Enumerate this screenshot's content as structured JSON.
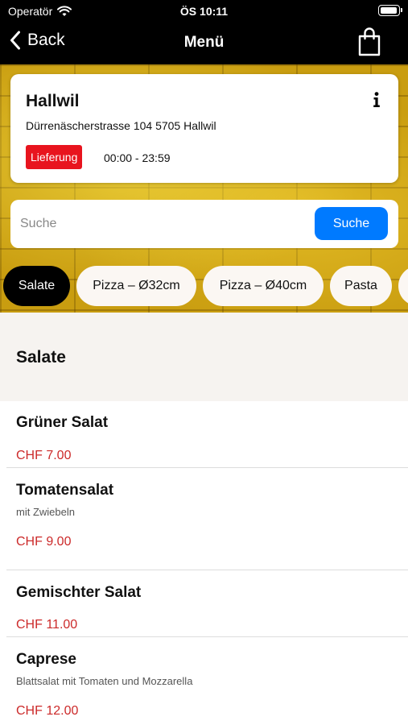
{
  "status_bar": {
    "carrier": "Operatör",
    "time": "ÖS 10:11"
  },
  "nav": {
    "back_label": "Back",
    "title": "Menü"
  },
  "store": {
    "name": "Hallwil",
    "address": "Dürrenäscherstrasse 104 5705 Hallwil",
    "badge": "Lieferung",
    "badge_color": "#e8141e",
    "hours": "00:00 - 23:59"
  },
  "search": {
    "placeholder": "Suche",
    "button_label": "Suche",
    "button_color": "#007aff"
  },
  "categories": [
    {
      "label": "Salate",
      "active": true
    },
    {
      "label": "Pizza – Ø32cm",
      "active": false
    },
    {
      "label": "Pizza – Ø40cm",
      "active": false
    },
    {
      "label": "Pasta",
      "active": false
    }
  ],
  "section": {
    "title": "Salate"
  },
  "items": [
    {
      "name": "Grüner Salat",
      "description": "",
      "price": "CHF 7.00"
    },
    {
      "name": "Tomatensalat",
      "description": "mit Zwiebeln",
      "price": "CHF 9.00"
    },
    {
      "name": "Gemischter Salat",
      "description": "",
      "price": "CHF 11.00"
    },
    {
      "name": "Caprese",
      "description": "Blattsalat mit Tomaten und Mozzarella",
      "price": "CHF 12.00"
    }
  ],
  "price_color": "#cc2a2a"
}
